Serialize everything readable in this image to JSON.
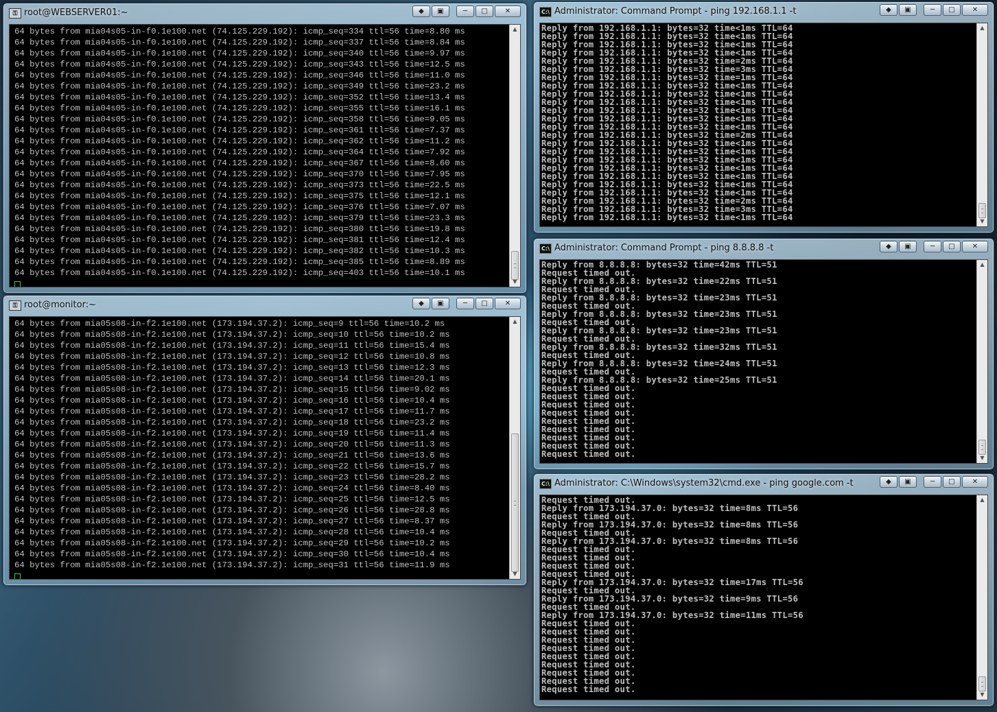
{
  "windows": {
    "putty1": {
      "title": "root@WEBSERVER01:~",
      "lines": [
        "64 bytes from mia04s05-in-f0.1e100.net (74.125.229.192): icmp_seq=334 ttl=56 time=8.80 ms",
        "64 bytes from mia04s05-in-f0.1e100.net (74.125.229.192): icmp_seq=337 ttl=56 time=8.84 ms",
        "64 bytes from mia04s05-in-f0.1e100.net (74.125.229.192): icmp_seq=340 ttl=56 time=9.97 ms",
        "64 bytes from mia04s05-in-f0.1e100.net (74.125.229.192): icmp_seq=343 ttl=56 time=12.5 ms",
        "64 bytes from mia04s05-in-f0.1e100.net (74.125.229.192): icmp_seq=346 ttl=56 time=11.0 ms",
        "64 bytes from mia04s05-in-f0.1e100.net (74.125.229.192): icmp_seq=349 ttl=56 time=23.2 ms",
        "64 bytes from mia04s05-in-f0.1e100.net (74.125.229.192): icmp_seq=352 ttl=56 time=13.4 ms",
        "64 bytes from mia04s05-in-f0.1e100.net (74.125.229.192): icmp_seq=355 ttl=56 time=16.1 ms",
        "64 bytes from mia04s05-in-f0.1e100.net (74.125.229.192): icmp_seq=358 ttl=56 time=9.05 ms",
        "64 bytes from mia04s05-in-f0.1e100.net (74.125.229.192): icmp_seq=361 ttl=56 time=7.37 ms",
        "64 bytes from mia04s05-in-f0.1e100.net (74.125.229.192): icmp_seq=362 ttl=56 time=11.2 ms",
        "64 bytes from mia04s05-in-f0.1e100.net (74.125.229.192): icmp_seq=364 ttl=56 time=7.92 ms",
        "64 bytes from mia04s05-in-f0.1e100.net (74.125.229.192): icmp_seq=367 ttl=56 time=8.60 ms",
        "64 bytes from mia04s05-in-f0.1e100.net (74.125.229.192): icmp_seq=370 ttl=56 time=7.95 ms",
        "64 bytes from mia04s05-in-f0.1e100.net (74.125.229.192): icmp_seq=373 ttl=56 time=22.5 ms",
        "64 bytes from mia04s05-in-f0.1e100.net (74.125.229.192): icmp_seq=375 ttl=56 time=12.1 ms",
        "64 bytes from mia04s05-in-f0.1e100.net (74.125.229.192): icmp_seq=376 ttl=56 time=7.07 ms",
        "64 bytes from mia04s05-in-f0.1e100.net (74.125.229.192): icmp_seq=379 ttl=56 time=23.3 ms",
        "64 bytes from mia04s05-in-f0.1e100.net (74.125.229.192): icmp_seq=380 ttl=56 time=19.8 ms",
        "64 bytes from mia04s05-in-f0.1e100.net (74.125.229.192): icmp_seq=381 ttl=56 time=12.4 ms",
        "64 bytes from mia04s05-in-f0.1e100.net (74.125.229.192): icmp_seq=382 ttl=56 time=10.3 ms",
        "64 bytes from mia04s05-in-f0.1e100.net (74.125.229.192): icmp_seq=385 ttl=56 time=8.89 ms",
        "64 bytes from mia04s05-in-f0.1e100.net (74.125.229.192): icmp_seq=403 ttl=56 time=10.1 ms"
      ]
    },
    "putty2": {
      "title": "root@monitor:~",
      "lines": [
        "64 bytes from mia05s08-in-f2.1e100.net (173.194.37.2): icmp_seq=9 ttl=56 time=10.2 ms",
        "64 bytes from mia05s08-in-f2.1e100.net (173.194.37.2): icmp_seq=10 ttl=56 time=10.2 ms",
        "64 bytes from mia05s08-in-f2.1e100.net (173.194.37.2): icmp_seq=11 ttl=56 time=15.4 ms",
        "64 bytes from mia05s08-in-f2.1e100.net (173.194.37.2): icmp_seq=12 ttl=56 time=10.8 ms",
        "64 bytes from mia05s08-in-f2.1e100.net (173.194.37.2): icmp_seq=13 ttl=56 time=12.3 ms",
        "64 bytes from mia05s08-in-f2.1e100.net (173.194.37.2): icmp_seq=14 ttl=56 time=20.1 ms",
        "64 bytes from mia05s08-in-f2.1e100.net (173.194.37.2): icmp_seq=15 ttl=56 time=9.02 ms",
        "64 bytes from mia05s08-in-f2.1e100.net (173.194.37.2): icmp_seq=16 ttl=56 time=10.4 ms",
        "64 bytes from mia05s08-in-f2.1e100.net (173.194.37.2): icmp_seq=17 ttl=56 time=11.7 ms",
        "64 bytes from mia05s08-in-f2.1e100.net (173.194.37.2): icmp_seq=18 ttl=56 time=23.2 ms",
        "64 bytes from mia05s08-in-f2.1e100.net (173.194.37.2): icmp_seq=19 ttl=56 time=11.4 ms",
        "64 bytes from mia05s08-in-f2.1e100.net (173.194.37.2): icmp_seq=20 ttl=56 time=11.3 ms",
        "64 bytes from mia05s08-in-f2.1e100.net (173.194.37.2): icmp_seq=21 ttl=56 time=13.6 ms",
        "64 bytes from mia05s08-in-f2.1e100.net (173.194.37.2): icmp_seq=22 ttl=56 time=15.7 ms",
        "64 bytes from mia05s08-in-f2.1e100.net (173.194.37.2): icmp_seq=23 ttl=56 time=28.2 ms",
        "64 bytes from mia05s08-in-f2.1e100.net (173.194.37.2): icmp_seq=24 ttl=56 time=8.40 ms",
        "64 bytes from mia05s08-in-f2.1e100.net (173.194.37.2): icmp_seq=25 ttl=56 time=12.5 ms",
        "64 bytes from mia05s08-in-f2.1e100.net (173.194.37.2): icmp_seq=26 ttl=56 time=28.8 ms",
        "64 bytes from mia05s08-in-f2.1e100.net (173.194.37.2): icmp_seq=27 ttl=56 time=8.37 ms",
        "64 bytes from mia05s08-in-f2.1e100.net (173.194.37.2): icmp_seq=28 ttl=56 time=10.4 ms",
        "64 bytes from mia05s08-in-f2.1e100.net (173.194.37.2): icmp_seq=29 ttl=56 time=10.2 ms",
        "64 bytes from mia05s08-in-f2.1e100.net (173.194.37.2): icmp_seq=30 ttl=56 time=10.4 ms",
        "64 bytes from mia05s08-in-f2.1e100.net (173.194.37.2): icmp_seq=31 ttl=56 time=11.9 ms"
      ]
    },
    "cmd1": {
      "title": "Administrator: Command Prompt - ping  192.168.1.1 -t",
      "lines": [
        "Reply from 192.168.1.1: bytes=32 time<1ms TTL=64",
        "Reply from 192.168.1.1: bytes=32 time<1ms TTL=64",
        "Reply from 192.168.1.1: bytes=32 time<1ms TTL=64",
        "Reply from 192.168.1.1: bytes=32 time<1ms TTL=64",
        "Reply from 192.168.1.1: bytes=32 time=2ms TTL=64",
        "Reply from 192.168.1.1: bytes=32 time=3ms TTL=64",
        "Reply from 192.168.1.1: bytes=32 time=1ms TTL=64",
        "Reply from 192.168.1.1: bytes=32 time<1ms TTL=64",
        "Reply from 192.168.1.1: bytes=32 time<1ms TTL=64",
        "Reply from 192.168.1.1: bytes=32 time<1ms TTL=64",
        "Reply from 192.168.1.1: bytes=32 time<1ms TTL=64",
        "Reply from 192.168.1.1: bytes=32 time<1ms TTL=64",
        "Reply from 192.168.1.1: bytes=32 time<1ms TTL=64",
        "Reply from 192.168.1.1: bytes=32 time=2ms TTL=64",
        "Reply from 192.168.1.1: bytes=32 time<1ms TTL=64",
        "Reply from 192.168.1.1: bytes=32 time<1ms TTL=64",
        "Reply from 192.168.1.1: bytes=32 time<1ms TTL=64",
        "Reply from 192.168.1.1: bytes=32 time<1ms TTL=64",
        "Reply from 192.168.1.1: bytes=32 time<1ms TTL=64",
        "Reply from 192.168.1.1: bytes=32 time<1ms TTL=64",
        "Reply from 192.168.1.1: bytes=32 time<1ms TTL=64",
        "Reply from 192.168.1.1: bytes=32 time=2ms TTL=64",
        "Reply from 192.168.1.1: bytes=32 time=3ms TTL=64",
        "Reply from 192.168.1.1: bytes=32 time<1ms TTL=64"
      ]
    },
    "cmd2": {
      "title": "Administrator: Command Prompt - ping  8.8.8.8 -t",
      "lines": [
        "Reply from 8.8.8.8: bytes=32 time=42ms TTL=51",
        "Request timed out.",
        "Reply from 8.8.8.8: bytes=32 time=22ms TTL=51",
        "Request timed out.",
        "Reply from 8.8.8.8: bytes=32 time=23ms TTL=51",
        "Request timed out.",
        "Reply from 8.8.8.8: bytes=32 time=23ms TTL=51",
        "Request timed out.",
        "Reply from 8.8.8.8: bytes=32 time=23ms TTL=51",
        "Request timed out.",
        "Reply from 8.8.8.8: bytes=32 time=32ms TTL=51",
        "Request timed out.",
        "Reply from 8.8.8.8: bytes=32 time=24ms TTL=51",
        "Request timed out.",
        "Reply from 8.8.8.8: bytes=32 time=25ms TTL=51",
        "Request timed out.",
        "Request timed out.",
        "Request timed out.",
        "Request timed out.",
        "Request timed out.",
        "Request timed out.",
        "Request timed out.",
        "Request timed out.",
        "Request timed out."
      ]
    },
    "cmd3": {
      "title": "Administrator: C:\\Windows\\system32\\cmd.exe - ping  google.com -t",
      "lines": [
        "Request timed out.",
        "Reply from 173.194.37.0: bytes=32 time=8ms TTL=56",
        "Request timed out.",
        "Reply from 173.194.37.0: bytes=32 time=8ms TTL=56",
        "Request timed out.",
        "Reply from 173.194.37.0: bytes=32 time=8ms TTL=56",
        "Request timed out.",
        "Request timed out.",
        "Request timed out.",
        "Request timed out.",
        "Reply from 173.194.37.0: bytes=32 time=17ms TTL=56",
        "Request timed out.",
        "Reply from 173.194.37.0: bytes=32 time=9ms TTL=56",
        "Request timed out.",
        "Reply from 173.194.37.0: bytes=32 time=11ms TTL=56",
        "Request timed out.",
        "Request timed out.",
        "Request timed out.",
        "Request timed out.",
        "Request timed out.",
        "Request timed out.",
        "Request timed out.",
        "Request timed out.",
        "Request timed out."
      ]
    }
  },
  "controls": {
    "restore_glyph": "◆",
    "pin_glyph": "▣",
    "minimize_glyph": "─",
    "maximize_glyph": "□",
    "close_glyph": "✕",
    "scroll_up_glyph": "▲",
    "scroll_down_glyph": "▼"
  },
  "icons": {
    "putty": "putty-icon",
    "cmd": "cmd-icon"
  },
  "colors": {
    "terminal_bg": "#000000",
    "terminal_text": "#c0c0c0",
    "cursor": "#3fd34a"
  }
}
